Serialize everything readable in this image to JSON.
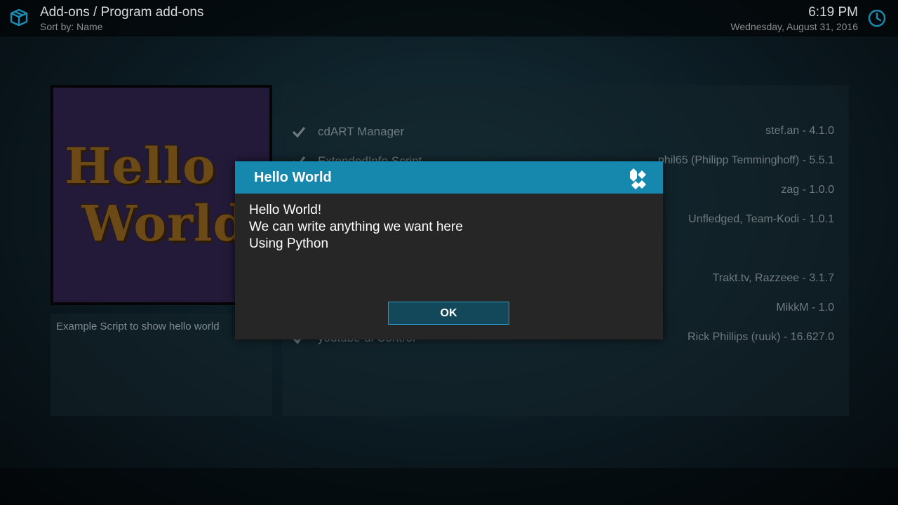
{
  "header": {
    "title": "Add-ons / Program add-ons",
    "sort": "Sort by: Name",
    "time": "6:19 PM",
    "date": "Wednesday, August 31, 2016"
  },
  "thumbnail": {
    "line1": "Hello",
    "line2": "World"
  },
  "description": "Example Script to show hello world",
  "addons": [
    {
      "name": "cdART Manager",
      "meta": "stef.an - 4.1.0",
      "enabled": true
    },
    {
      "name": "ExtendedInfo Script",
      "meta": "phil65 (Philipp Temminghoff) - 5.5.1",
      "enabled": true
    },
    {
      "name": "",
      "meta": "zag - 1.0.0",
      "enabled": false
    },
    {
      "name": "",
      "meta": "Unfledged, Team-Kodi - 1.0.1",
      "enabled": false
    },
    {
      "name": "",
      "meta": "",
      "enabled": false
    },
    {
      "name": "",
      "meta": "Trakt.tv, Razzeee - 3.1.7",
      "enabled": false
    },
    {
      "name": "",
      "meta": "MikkM - 1.0",
      "enabled": false
    },
    {
      "name": "youtube-dl Control",
      "meta": "Rick Phillips (ruuk) - 16.627.0",
      "enabled": true
    }
  ],
  "dialog": {
    "title": "Hello World",
    "lines": [
      "Hello World!",
      "We can write anything we want here",
      "Using Python"
    ],
    "ok_label": "OK"
  },
  "colors": {
    "accent": "#1788ad",
    "dialog_bg": "#262626",
    "button_bg": "#12485a"
  },
  "icons": {
    "app": "addon-box-icon",
    "clock": "clock-icon",
    "check": "check-icon",
    "logo": "kodi-logo-icon"
  }
}
